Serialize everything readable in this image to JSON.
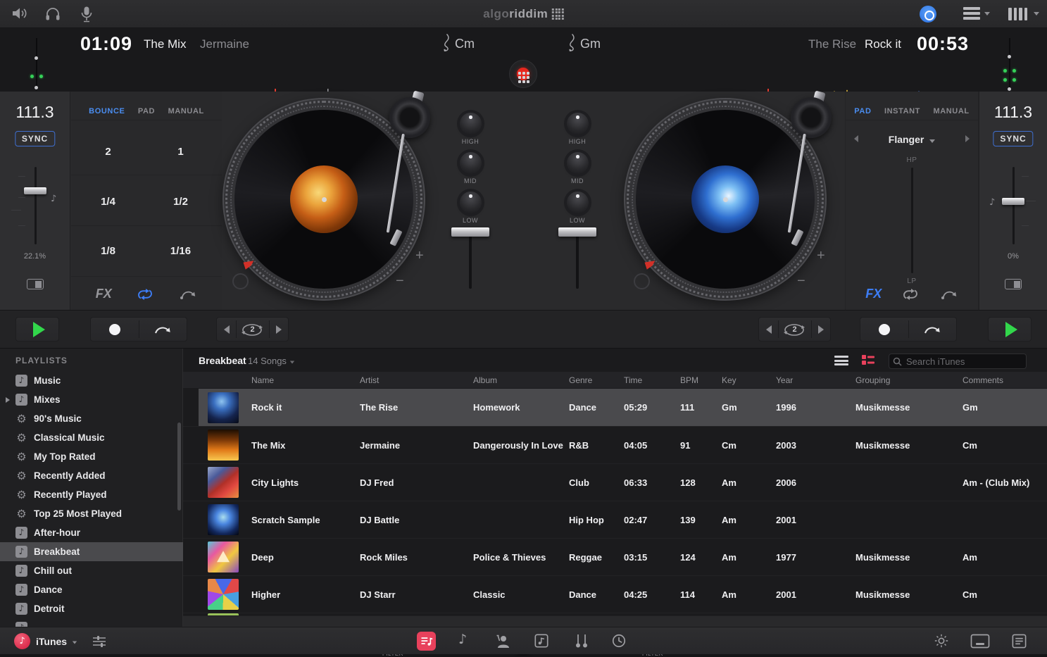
{
  "top_bar": {
    "logo": {
      "part1": "algo",
      "part2": "riddim"
    },
    "left_icons": [
      "speaker-icon",
      "headphones-icon",
      "microphone-icon"
    ],
    "right_icons": [
      "disc-recording-icon",
      "layout-icon",
      "midi-devices-icon"
    ]
  },
  "deck_a": {
    "time": "01:09",
    "title": "The Mix",
    "artist": "Jermaine",
    "key": "Cm",
    "bpm": "111.3",
    "sync_label": "SYNC",
    "pitch_percent": "22.1%",
    "tabs": {
      "items": [
        "BOUNCE",
        "PAD",
        "MANUAL"
      ],
      "active": "BOUNCE"
    },
    "loop_grid": [
      "2",
      "1",
      "1/4",
      "1/2",
      "1/8",
      "1/16"
    ],
    "fx_label": "FX",
    "loop_length": "2"
  },
  "deck_b": {
    "time": "00:53",
    "title": "Rock it",
    "artist": "The Rise",
    "key": "Gm",
    "bpm": "111.3",
    "sync_label": "SYNC",
    "pitch_percent": "0%",
    "tabs": {
      "items": [
        "PAD",
        "INSTANT",
        "MANUAL"
      ],
      "active": "PAD"
    },
    "fx_name": "Flanger",
    "filter_hp": "HP",
    "filter_lp": "LP",
    "fx_label": "FX",
    "loop_length": "2"
  },
  "mixer": {
    "eq": [
      "HIGH",
      "MID",
      "LOW"
    ],
    "filter_label": "FILTER"
  },
  "sidebar": {
    "header": "PLAYLISTS",
    "items": [
      {
        "label": "Music",
        "icon": "playlist-note"
      },
      {
        "label": "Mixes",
        "icon": "playlist-note",
        "expandable": true
      },
      {
        "label": "90's Music",
        "icon": "smart-playlist"
      },
      {
        "label": "Classical Music",
        "icon": "smart-playlist"
      },
      {
        "label": "My Top Rated",
        "icon": "smart-playlist"
      },
      {
        "label": "Recently Added",
        "icon": "smart-playlist"
      },
      {
        "label": "Recently Played",
        "icon": "smart-playlist"
      },
      {
        "label": "Top 25 Most Played",
        "icon": "smart-playlist"
      },
      {
        "label": "After-hour",
        "icon": "playlist-note"
      },
      {
        "label": "Breakbeat",
        "icon": "playlist-note",
        "selected": true
      },
      {
        "label": "Chill out",
        "icon": "playlist-note"
      },
      {
        "label": "Dance",
        "icon": "playlist-note"
      },
      {
        "label": "Detroit",
        "icon": "playlist-note"
      }
    ],
    "source": {
      "label": "iTunes"
    }
  },
  "library": {
    "playlist_name": "Breakbeat",
    "song_count": "14 Songs",
    "search_placeholder": "Search iTunes",
    "columns": [
      "Name",
      "Artist",
      "Album",
      "Genre",
      "Time",
      "BPM",
      "Key",
      "Year",
      "Grouping",
      "Comments"
    ],
    "rows": [
      {
        "selected": true,
        "name": "Rock it",
        "artist": "The Rise",
        "album": "Homework",
        "genre": "Dance",
        "time": "05:29",
        "bpm": "111",
        "key": "Gm",
        "year": "1996",
        "grouping": "Musikmesse",
        "comments": "Gm"
      },
      {
        "name": "The Mix",
        "artist": "Jermaine",
        "album": "Dangerously In Love",
        "genre": "R&B",
        "time": "04:05",
        "bpm": "91",
        "key": "Cm",
        "year": "2003",
        "grouping": "Musikmesse",
        "comments": "Cm"
      },
      {
        "name": "City Lights",
        "artist": "DJ Fred",
        "album": "",
        "genre": "Club",
        "time": "06:33",
        "bpm": "128",
        "key": "Am",
        "year": "2006",
        "grouping": "",
        "comments": "Am - (Club Mix)"
      },
      {
        "name": "Scratch Sample",
        "artist": "DJ Battle",
        "album": "",
        "genre": "Hip Hop",
        "time": "02:47",
        "bpm": "139",
        "key": "Am",
        "year": "2001",
        "grouping": "",
        "comments": ""
      },
      {
        "name": "Deep",
        "artist": "Rock Miles",
        "album": "Police & Thieves",
        "genre": "Reggae",
        "time": "03:15",
        "bpm": "124",
        "key": "Am",
        "year": "1977",
        "grouping": "Musikmesse",
        "comments": "Am"
      },
      {
        "name": "Higher",
        "artist": "DJ Starr",
        "album": "Classic",
        "genre": "Dance",
        "time": "04:25",
        "bpm": "114",
        "key": "Am",
        "year": "2001",
        "grouping": "Musikmesse",
        "comments": "Cm"
      }
    ]
  },
  "bottom_bar": {
    "source_icons": [
      "playlists-icon",
      "songs-icon",
      "artists-icon",
      "albums-icon",
      "genres-icon",
      "history-icon"
    ],
    "right_icons": [
      "brightness-icon",
      "keyboard-display-icon",
      "queue-list-icon"
    ]
  },
  "colors": {
    "accent_blue": "#4a8df0",
    "record_red": "#e8271e",
    "play_green": "#32d74b",
    "pink": "#e8415c",
    "sync_border": "#3f6fd0",
    "waveform_palette": [
      "#c9a53a",
      "#a4c43c",
      "#49b86a",
      "#3aa0c8",
      "#4a7ad8"
    ]
  }
}
